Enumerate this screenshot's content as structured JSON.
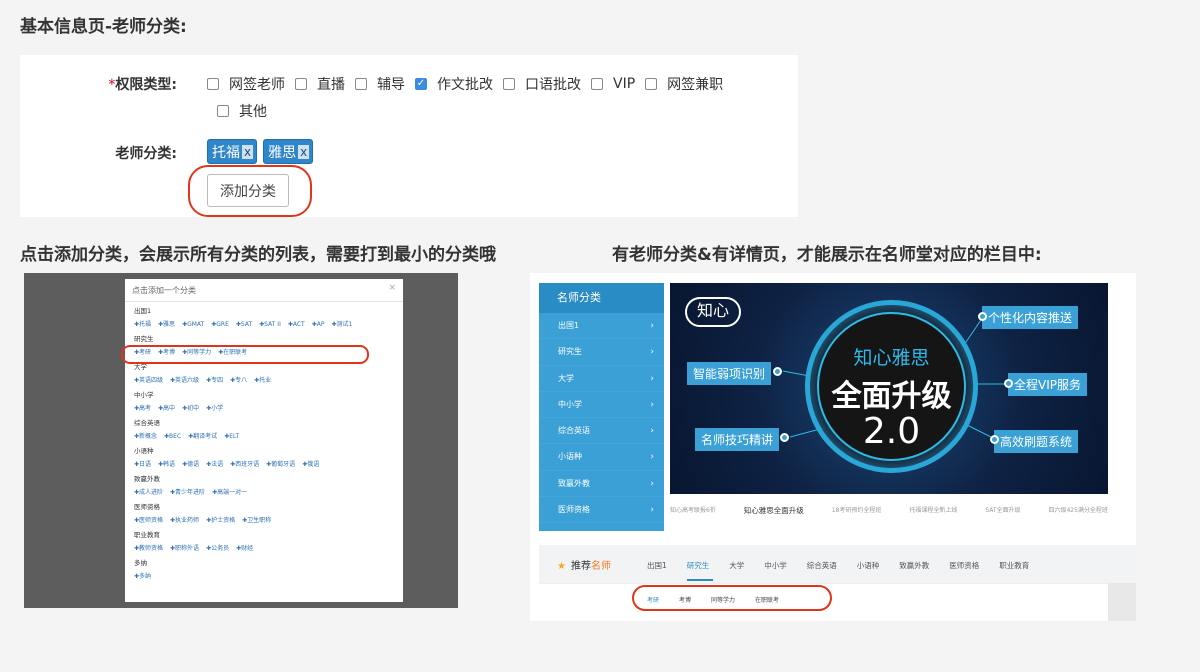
{
  "headings": {
    "top": "基本信息页-老师分类:",
    "left": "点击添加分类，会展示所有分类的列表，需要打到最小的分类哦",
    "right": "有老师分类&有详情页，才能展示在名师堂对应的栏目中:"
  },
  "form": {
    "required_mark": "*",
    "permission_label": "权限类型:",
    "permission_options": [
      {
        "label": "网签老师",
        "checked": false
      },
      {
        "label": "直播",
        "checked": false
      },
      {
        "label": "辅导",
        "checked": false
      },
      {
        "label": "作文批改",
        "checked": true
      },
      {
        "label": "口语批改",
        "checked": false
      },
      {
        "label": "VIP",
        "checked": false
      },
      {
        "label": "网签兼职",
        "checked": false
      },
      {
        "label": "其他",
        "checked": false
      }
    ],
    "category_label": "老师分类:",
    "tags": [
      {
        "label": "托福",
        "remove": "x"
      },
      {
        "label": "雅思",
        "remove": "x"
      }
    ],
    "add_button": "添加分类"
  },
  "modal": {
    "title": "点击添加一个分类",
    "close": "×",
    "categories": [
      {
        "name": "出国1",
        "items": [
          "✚托福",
          "✚雅思",
          "✚GMAT",
          "✚GRE",
          "✚SAT",
          "✚SAT II",
          "✚ACT",
          "✚AP",
          "✚测试1"
        ]
      },
      {
        "name": "研究生",
        "items": [
          "✚考研",
          "✚考博",
          "✚同等学力",
          "✚在职联考"
        ]
      },
      {
        "name": "大学",
        "items": [
          "✚英语四级",
          "✚英语六级",
          "✚专四",
          "✚专八",
          "✚托业"
        ]
      },
      {
        "name": "中小学",
        "items": [
          "✚高考",
          "✚高中",
          "✚初中",
          "✚小学"
        ]
      },
      {
        "name": "综合英语",
        "items": [
          "✚新概念",
          "✚BEC",
          "✚翻译考试",
          "✚ELT"
        ]
      },
      {
        "name": "小语种",
        "items": [
          "✚日语",
          "✚韩语",
          "✚德语",
          "✚法语",
          "✚西班牙语",
          "✚葡萄牙语",
          "✚俄语"
        ]
      },
      {
        "name": "致赢外教",
        "items": [
          "✚成人进阶",
          "✚青少年进阶",
          "✚高端一对一"
        ]
      },
      {
        "name": "医师资格",
        "items": [
          "✚医师资格",
          "✚执业药师",
          "✚护士资格",
          "✚卫生职称"
        ]
      },
      {
        "name": "职业教育",
        "items": [
          "✚教师资格",
          "✚职称外语",
          "✚公务员",
          "✚财经"
        ]
      },
      {
        "name": "多纳",
        "items": [
          "✚多纳"
        ]
      }
    ]
  },
  "site": {
    "sidebar_title": "名师分类",
    "sidebar_items": [
      "出国1",
      "研究生",
      "大学",
      "中小学",
      "综合英语",
      "小语种",
      "致赢外教",
      "医师资格"
    ],
    "chevron": "›",
    "banner": {
      "logo": "知心",
      "subtitle": "知心雅思",
      "title": "全面升级",
      "version": "2.0",
      "features_left": [
        "智能弱项识别",
        "名师技巧精讲"
      ],
      "features_right": [
        "个性化内容推送",
        "全程VIP服务",
        "高效刷题系统"
      ]
    },
    "banner_tabs": [
      "知心高考联报6折",
      "知心雅思全面升级",
      "18考研预约全程班",
      "托福课程全新上线",
      "SAT全面升级",
      "四六级425满分全程班"
    ],
    "banner_tab_active": 1,
    "recommend": {
      "star": "★",
      "prefix": "推荐",
      "highlight": "名师",
      "tabs": [
        "出国1",
        "研究生",
        "大学",
        "中小学",
        "综合英语",
        "小语种",
        "致赢外教",
        "医师资格",
        "职业教育"
      ],
      "active_tab": 1,
      "sub_tabs": [
        "考研",
        "考博",
        "同等学力",
        "在职联考"
      ],
      "active_sub_tab": 0
    }
  },
  "colors": {
    "accent": "#3aa0d6",
    "highlight_ring": "#e0351b",
    "tag_bg": "#2f86c8"
  }
}
